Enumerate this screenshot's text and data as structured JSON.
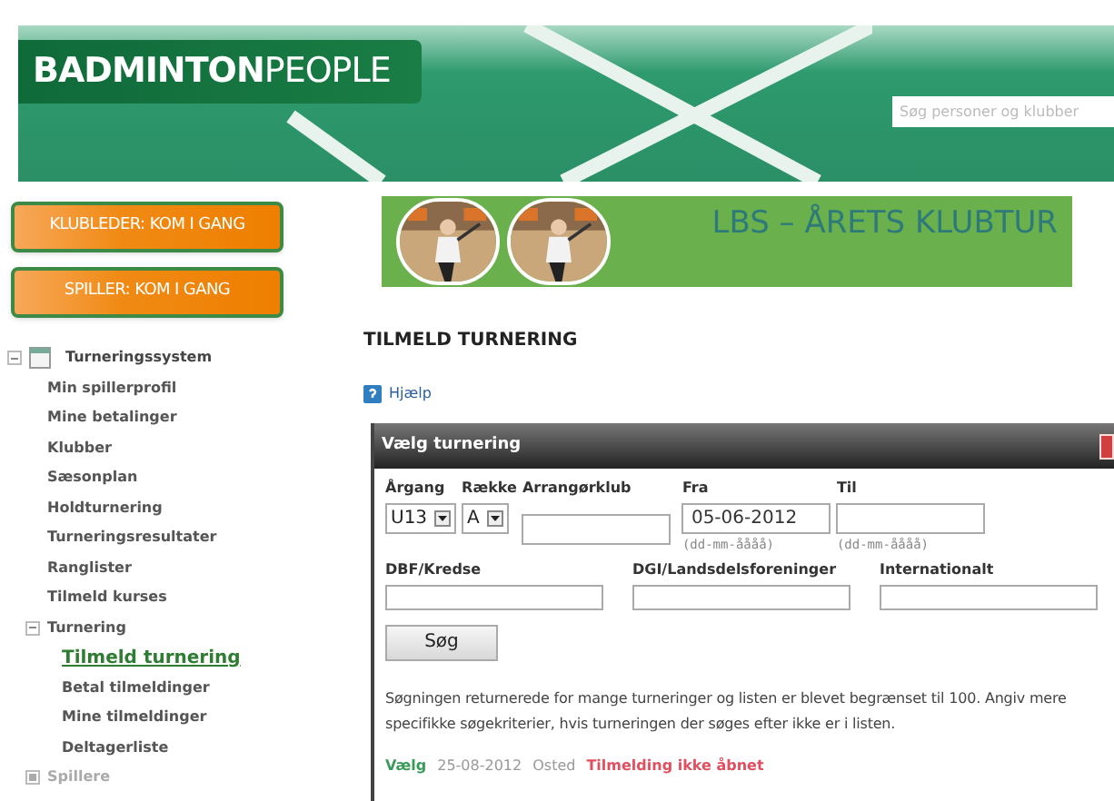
{
  "header": {
    "logo_bold": "BADMINTON",
    "logo_light": "PEOPLE",
    "search": {
      "placeholder": "Søg personer og klubber"
    }
  },
  "sidebar": {
    "buttons": [
      "KLUBLEDER: KOM I GANG",
      "SPILLER: KOM I GANG"
    ],
    "tree": [
      {
        "label": "Turneringssystem",
        "expanded": true,
        "children": [
          {
            "label": "Min spillerprofil",
            "selected": false
          },
          {
            "label": "Mine betalinger",
            "selected": false
          },
          {
            "label": "Klubber",
            "selected": false
          },
          {
            "label": "Sæsonplan",
            "selected": false
          },
          {
            "label": "Holdturnering",
            "selected": false
          },
          {
            "label": "Turneringsresultater",
            "selected": false
          },
          {
            "label": "Ranglister",
            "selected": false
          },
          {
            "label": "Tilmeld kurses",
            "selected": false
          },
          {
            "label": "Turnering",
            "expanded": true,
            "children": [
              {
                "label": "Tilmeld turnering",
                "selected": true
              },
              {
                "label": "Betal tilmeldinger",
                "selected": false
              },
              {
                "label": "Mine tilmeldinger",
                "selected": false
              },
              {
                "label": "Deltagerliste",
                "selected": false
              }
            ]
          },
          {
            "label": "Spillere",
            "expanded": false
          }
        ]
      }
    ]
  },
  "banner": {
    "title": "LBS – ÅRETS KLUBTUR"
  },
  "page_title": "TILMELD TURNERING",
  "help_link": "Hjælp",
  "dialog": {
    "title": "Vælg turnering",
    "row1": [
      {
        "label": "Årgang",
        "kind": "select",
        "value": "U13"
      },
      {
        "label": "Række",
        "kind": "select",
        "value": "A"
      },
      {
        "label": "Arrangørklub",
        "kind": "text"
      },
      {
        "label": "Fra",
        "kind": "date",
        "value": "05-06-2012",
        "hint": "(dd-mm-åååå)"
      },
      {
        "label": "Til",
        "kind": "date",
        "hint": "(dd-mm-åååå)"
      }
    ],
    "row2": [
      {
        "label": "DBF/Kredse"
      },
      {
        "label": "DGI/Landsdelsforeninger"
      },
      {
        "label": "Internationalt"
      }
    ],
    "search_button": "Søg",
    "message": "Søgningen returnerede for mange turneringer og listen er blevet begrænset til 100. Angiv mere specifikke søgekriterier, hvis turneringen der søges efter ikke er i listen.",
    "result": {
      "action": "Vælg",
      "date": "25-08-2012",
      "place": "Osted",
      "status": "Tilmelding ikke åbnet"
    }
  }
}
